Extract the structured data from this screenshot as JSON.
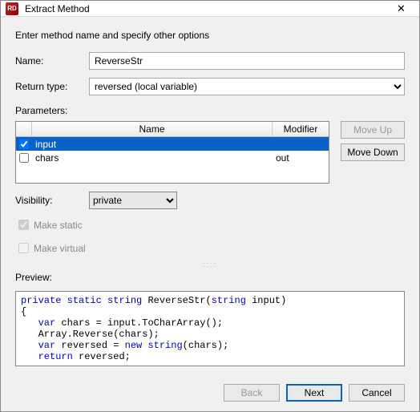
{
  "window": {
    "title": "Extract Method",
    "icon_text": "RD"
  },
  "subtitle": "Enter method name and specify other options",
  "labels": {
    "name": "Name:",
    "return_type": "Return type:",
    "parameters": "Parameters:",
    "visibility": "Visibility:",
    "make_static": "Make static",
    "make_virtual": "Make virtual",
    "preview": "Preview:"
  },
  "fields": {
    "name_value": "ReverseStr",
    "return_type_value": "reversed (local variable)",
    "visibility_value": "private"
  },
  "params_header": {
    "name": "Name",
    "modifier": "Modifier"
  },
  "params": [
    {
      "checked": true,
      "name": "input",
      "modifier": "",
      "selected": true
    },
    {
      "checked": false,
      "name": "chars",
      "modifier": "out",
      "selected": false
    }
  ],
  "buttons": {
    "move_up": "Move Up",
    "move_down": "Move Down",
    "back": "Back",
    "next": "Next",
    "cancel": "Cancel"
  },
  "checkboxes": {
    "make_static_checked": true,
    "make_virtual_checked": false
  },
  "preview_code": {
    "kw_private": "private",
    "kw_static": "static",
    "kw_string1": "string",
    "fn_name": "ReverseStr",
    "kw_string2": "string",
    "param": "input",
    "line_open": "{",
    "kw_var1": "var",
    "l2": " chars = input.ToCharArray();",
    "l3": "   Array.Reverse(chars);",
    "kw_var2": "var",
    "l4": " reversed = ",
    "kw_new": "new",
    "l4b": " ",
    "kw_string3": "string",
    "l4c": "(chars);",
    "kw_return": "return",
    "l5": " reversed;"
  }
}
